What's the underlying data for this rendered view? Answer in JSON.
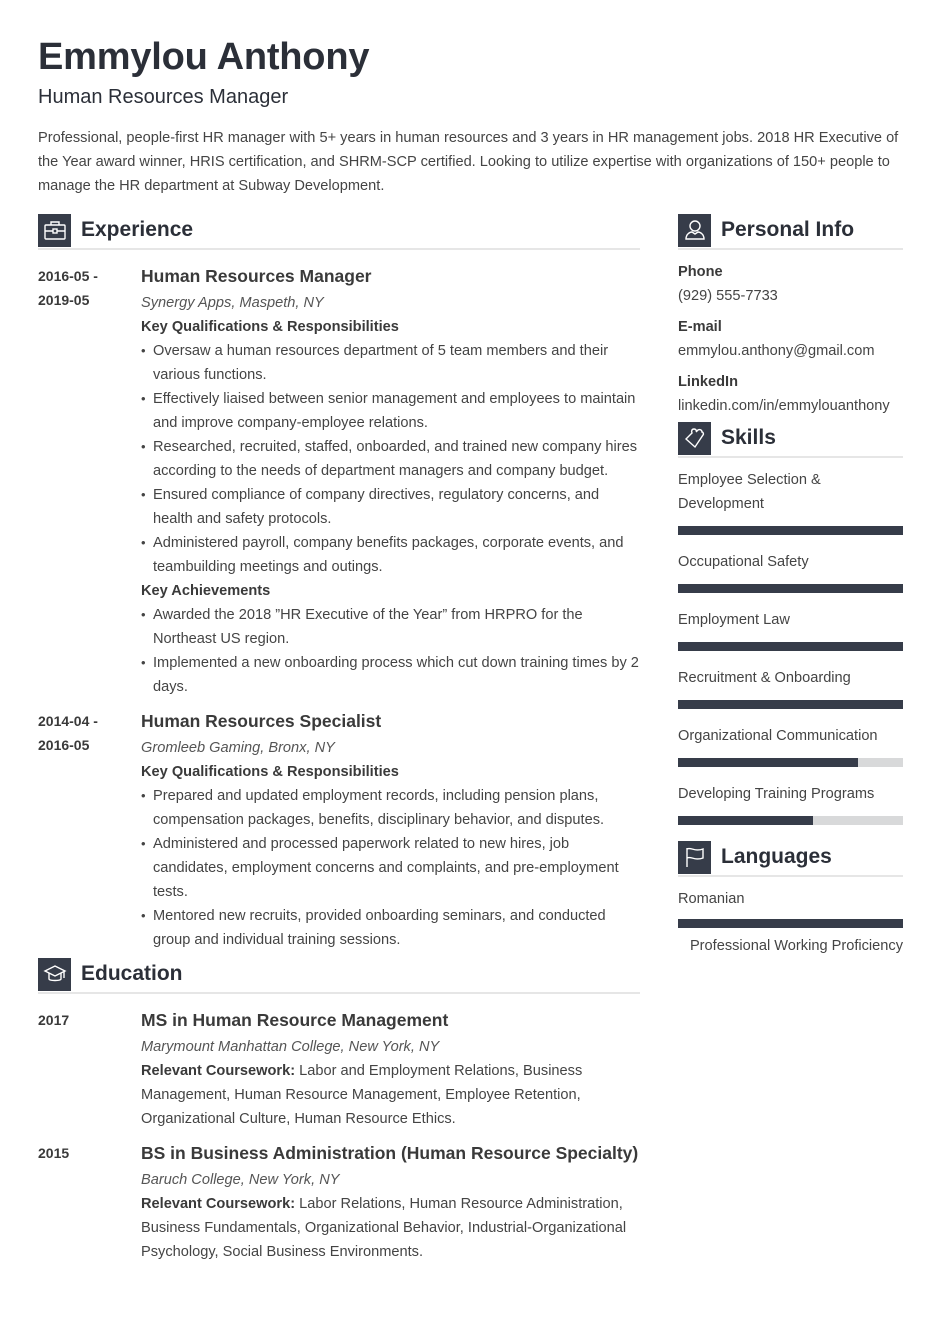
{
  "header": {
    "name": "Emmylou Anthony",
    "role": "Human Resources Manager",
    "summary": "Professional, people-first HR manager with 5+ years in human resources and 3 years in HR management jobs. 2018 HR Executive of the Year award winner, HRIS certification, and SHRM-SCP certified. Looking to utilize expertise with organizations of 150+ people to manage the HR department at Subway Development."
  },
  "experience": {
    "title": "Experience",
    "icon": "briefcase-icon",
    "entries": [
      {
        "date_start": "2016-05 -",
        "date_end": "2019-05",
        "title": "Human Resources Manager",
        "org": "Synergy Apps, Maspeth, NY",
        "qual_heading": "Key Qualifications & Responsibilities",
        "qualifications": [
          "Oversaw a human resources department of 5 team members and their various functions.",
          "Effectively liaised between senior management and employees to maintain and improve company-employee relations.",
          "Researched, recruited, staffed, onboarded, and trained new company hires according to the needs of department managers and company budget.",
          "Ensured compliance of company directives, regulatory concerns, and health and safety protocols.",
          "Administered payroll, company benefits packages, corporate events, and teambuilding meetings and outings."
        ],
        "ach_heading": "Key Achievements",
        "achievements": [
          "Awarded the 2018 ”HR Executive of the Year” from HRPRO for the Northeast US region.",
          "Implemented a new onboarding process which cut down training times by 2 days."
        ]
      },
      {
        "date_start": "2014-04 -",
        "date_end": "2016-05",
        "title": "Human Resources Specialist",
        "org": "Gromleeb Gaming, Bronx, NY",
        "qual_heading": "Key Qualifications & Responsibilities",
        "qualifications": [
          "Prepared and updated employment records, including pension plans, compensation packages, benefits, disciplinary behavior, and disputes.",
          "Administered and processed paperwork related to new hires, job candidates, employment concerns and complaints, and pre-employment tests.",
          "Mentored new recruits, provided onboarding seminars, and conducted group and individual training sessions."
        ]
      }
    ]
  },
  "education": {
    "title": "Education",
    "icon": "graduation-cap-icon",
    "entries": [
      {
        "date": "2017",
        "title": "MS in Human Resource Management",
        "org": "Marymount Manhattan College, New York, NY",
        "course_label": "Relevant Coursework:",
        "courses": " Labor and Employment Relations, Business Management, Human Resource Management, Employee Retention, Organizational Culture, Human Resource Ethics."
      },
      {
        "date": "2015",
        "title": "BS in Business Administration (Human Resource Specialty)",
        "org": "Baruch College, New York, NY",
        "course_label": "Relevant Coursework:",
        "courses": " Labor Relations, Human Resource Administration, Business Fundamentals, Organizational Behavior, Industrial-Organizational Psychology, Social Business Environments."
      }
    ]
  },
  "personal_info": {
    "title": "Personal Info",
    "icon": "user-icon",
    "items": [
      {
        "label": "Phone",
        "value": "(929) 555-7733"
      },
      {
        "label": "E-mail",
        "value": "emmylou.anthony@gmail.com"
      },
      {
        "label": "LinkedIn",
        "value": "linkedin.com/in/emmylouanthony"
      }
    ]
  },
  "skills": {
    "title": "Skills",
    "icon": "puzzle-piece-icon",
    "items": [
      {
        "name": "Employee Selection & Development",
        "level": 1.0
      },
      {
        "name": "Occupational Safety",
        "level": 1.0
      },
      {
        "name": "Employment Law",
        "level": 1.0
      },
      {
        "name": "Recruitment & Onboarding",
        "level": 1.0
      },
      {
        "name": "Organizational Communication",
        "level": 0.8
      },
      {
        "name": "Developing Training Programs",
        "level": 0.6
      }
    ]
  },
  "languages": {
    "title": "Languages",
    "icon": "flag-icon",
    "items": [
      {
        "name": "Romanian",
        "level": 1.0,
        "proficiency": "Professional Working Proficiency"
      }
    ]
  },
  "colors": {
    "accent": "#363c49",
    "bar_track": "#d8d9da",
    "divider": "#e6e6e6",
    "text": "#3a3a3a"
  }
}
